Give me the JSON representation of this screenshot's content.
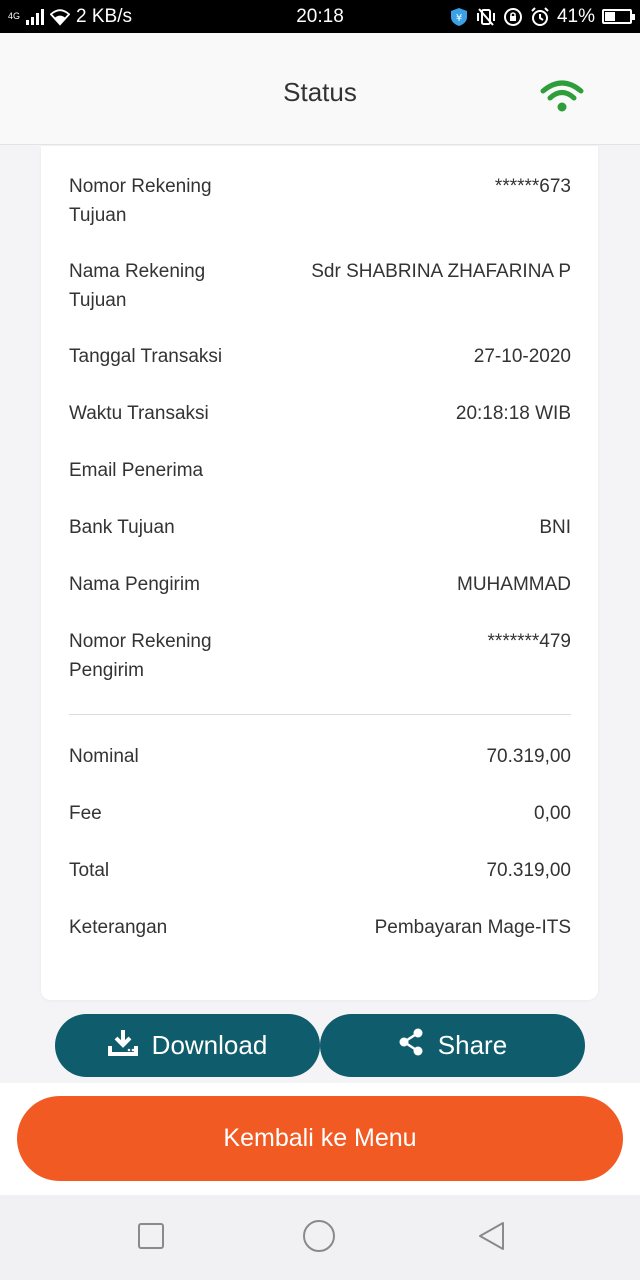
{
  "status_bar": {
    "network_type": "4G",
    "speed": "2 KB/s",
    "time": "20:18",
    "battery": "41%",
    "battery_level": 0.41
  },
  "header": {
    "title": "Status",
    "connection_icon": "wifi-icon",
    "accent_color": "#2e9e3a"
  },
  "details": [
    {
      "label": "Nomor Rekening Tujuan",
      "value": "******673"
    },
    {
      "label": "Nama Rekening Tujuan",
      "value": "Sdr SHABRINA ZHAFARINA P"
    },
    {
      "label": "Tanggal Transaksi",
      "value": "27-10-2020"
    },
    {
      "label": "Waktu Transaksi",
      "value": "20:18:18 WIB"
    },
    {
      "label": "Email Penerima",
      "value": ""
    },
    {
      "label": "Bank Tujuan",
      "value": "BNI"
    },
    {
      "label": "Nama Pengirim",
      "value": "MUHAMMAD"
    },
    {
      "label": "Nomor Rekening Pengirim",
      "value": "*******479"
    }
  ],
  "amounts": [
    {
      "label": "Nominal",
      "value": "70.319,00"
    },
    {
      "label": "Fee",
      "value": "0,00"
    },
    {
      "label": "Total",
      "value": "70.319,00"
    },
    {
      "label": "Keterangan",
      "value": "Pembayaran Mage-ITS"
    }
  ],
  "actions": {
    "download_label": "Download",
    "share_label": "Share",
    "back_label": "Kembali ke Menu",
    "primary_color": "#0f5c6c",
    "back_color": "#f15a22"
  },
  "nav": {
    "recent_icon": "square-icon",
    "home_icon": "circle-icon",
    "back_icon": "triangle-back-icon"
  }
}
